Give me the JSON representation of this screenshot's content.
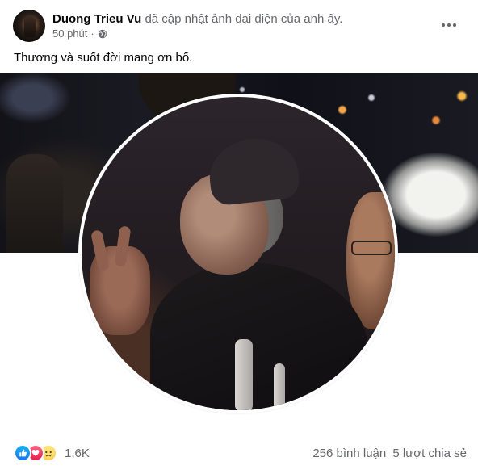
{
  "post": {
    "author_name": "Duong Trieu Vu",
    "action_text": "đã cập nhật ảnh đại diện của anh ấy.",
    "timestamp": "50 phút",
    "separator": "·",
    "privacy_icon": "globe-icon",
    "caption": "Thương và suốt đời mang ơn bố."
  },
  "footer": {
    "reaction_icons": [
      "like-icon",
      "love-icon",
      "sad-icon"
    ],
    "reaction_count": "1,6K",
    "comments": "256 bình luận",
    "shares": "5 lượt chia sẻ"
  },
  "colors": {
    "accent": "#1877f2",
    "secondary_text": "#65676b",
    "like": "#1877f2",
    "love": "#e61e4d",
    "sad": "#f7b125"
  }
}
